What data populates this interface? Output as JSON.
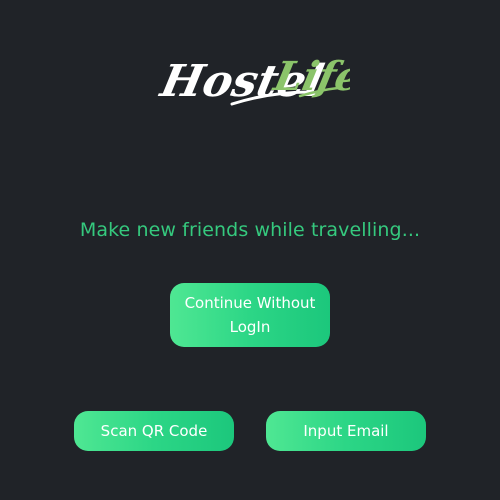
{
  "logo": {
    "text_part1": "Hostel",
    "text_part2": "Life",
    "color_primary": "#ffffff",
    "color_accent": "#8bc46a"
  },
  "tagline": "Make new friends while travelling...",
  "buttons": {
    "continue_label": "Continue Without LogIn",
    "scan_label": "Scan QR Code",
    "email_label": "Input Email"
  },
  "colors": {
    "background": "#202328",
    "accent_green": "#35c97e",
    "button_gradient_start": "#4fe793",
    "button_gradient_end": "#1cc77c"
  }
}
